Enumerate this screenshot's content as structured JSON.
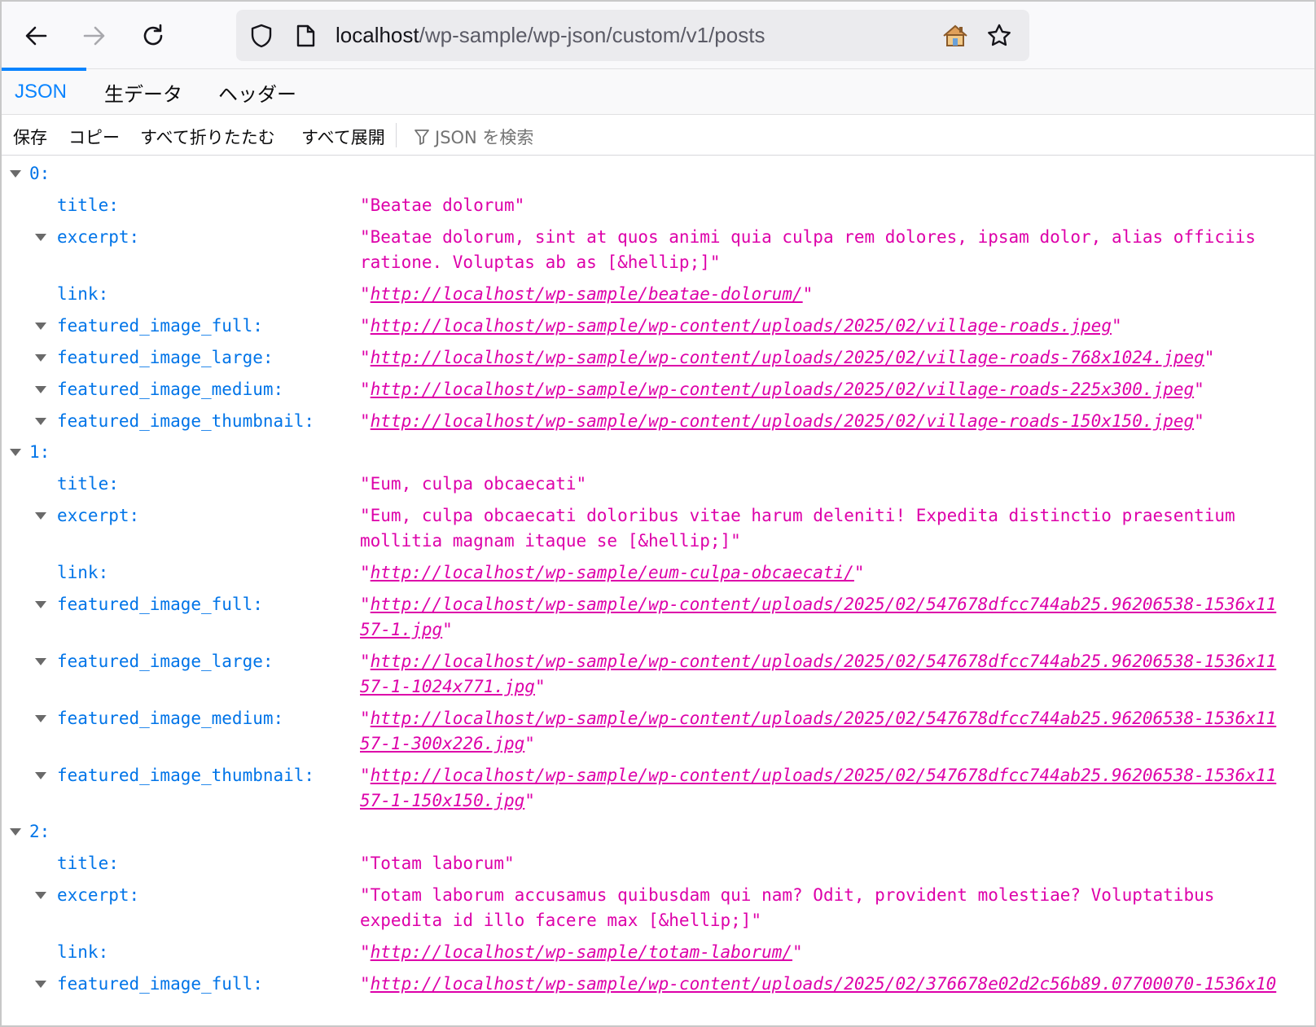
{
  "browser": {
    "url_host": "localhost",
    "url_path": "/wp-sample/wp-json/custom/v1/posts"
  },
  "tabs": [
    "JSON",
    "生データ",
    "ヘッダー"
  ],
  "toolbar": {
    "save": "保存",
    "copy": "コピー",
    "collapse_all": "すべて折りたたむ",
    "expand_all": "すべて展開",
    "filter_placeholder": "JSON を検索"
  },
  "tree": {
    "items": [
      {
        "index": "0:",
        "title_key": "title:",
        "title": "\"Beatae dolorum\"",
        "excerpt_key": "excerpt:",
        "excerpt_line1": "\"Beatae dolorum, sint at quos animi quia culpa rem dolores, ipsam dolor, alias officiis",
        "excerpt_line2": "ratione. Voluptas ab as [&hellip;]\"",
        "link_key": "link:",
        "link": "http://localhost/wp-sample/beatae-dolorum/",
        "full_key": "featured_image_full:",
        "full": "http://localhost/wp-sample/wp-content/uploads/2025/02/village-roads.jpeg",
        "large_key": "featured_image_large:",
        "large": "http://localhost/wp-sample/wp-content/uploads/2025/02/village-roads-768x1024.jpeg",
        "medium_key": "featured_image_medium:",
        "medium": "http://localhost/wp-sample/wp-content/uploads/2025/02/village-roads-225x300.jpeg",
        "thumb_key": "featured_image_thumbnail:",
        "thumb": "http://localhost/wp-sample/wp-content/uploads/2025/02/village-roads-150x150.jpeg"
      },
      {
        "index": "1:",
        "title_key": "title:",
        "title": "\"Eum, culpa obcaecati\"",
        "excerpt_key": "excerpt:",
        "excerpt_line1": "\"Eum, culpa obcaecati doloribus vitae harum deleniti! Expedita distinctio praesentium",
        "excerpt_line2": "mollitia magnam itaque se [&hellip;]\"",
        "link_key": "link:",
        "link": "http://localhost/wp-sample/eum-culpa-obcaecati/",
        "full_key": "featured_image_full:",
        "full_l1": "http://localhost/wp-sample/wp-content/uploads/2025/02/547678dfcc744ab25.96206538-1536x11",
        "full_l2": "57-1.jpg",
        "large_key": "featured_image_large:",
        "large_l1": "http://localhost/wp-sample/wp-content/uploads/2025/02/547678dfcc744ab25.96206538-1536x11",
        "large_l2": "57-1-1024x771.jpg",
        "medium_key": "featured_image_medium:",
        "medium_l1": "http://localhost/wp-sample/wp-content/uploads/2025/02/547678dfcc744ab25.96206538-1536x11",
        "medium_l2": "57-1-300x226.jpg",
        "thumb_key": "featured_image_thumbnail:",
        "thumb_l1": "http://localhost/wp-sample/wp-content/uploads/2025/02/547678dfcc744ab25.96206538-1536x11",
        "thumb_l2": "57-1-150x150.jpg"
      },
      {
        "index": "2:",
        "title_key": "title:",
        "title": "\"Totam laborum\"",
        "excerpt_key": "excerpt:",
        "excerpt_line1": "\"Totam laborum accusamus quibusdam qui nam? Odit, provident molestiae? Voluptatibus",
        "excerpt_line2": "expedita id illo facere max [&hellip;]\"",
        "link_key": "link:",
        "link": "http://localhost/wp-sample/totam-laborum/",
        "full_key": "featured_image_full:",
        "full_l1": "http://localhost/wp-sample/wp-content/uploads/2025/02/376678e02d2c56b89.07700070-1536x10"
      }
    ]
  }
}
